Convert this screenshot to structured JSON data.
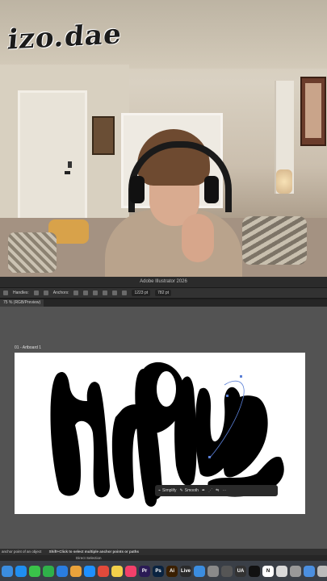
{
  "overlay": {
    "logo_text": "izo.dae"
  },
  "app": {
    "title": "Adobe Illustrator 2026"
  },
  "controlbar": {
    "handles_label": "Handles:",
    "anchors_label": "Anchors:",
    "x_value": "1223 pt",
    "y_value": "782 pt"
  },
  "document_tab": {
    "label": "75 % (RGB/Preview)"
  },
  "artboard": {
    "label": "01 - Artboard 1",
    "lettering": "unpluug"
  },
  "context_bar": {
    "simplify_label": "Simplify",
    "smooth_label": "Smooth"
  },
  "statusbar": {
    "text": "anchor point of an object",
    "hint": "Shift+Click to select multiple anchor points or paths",
    "tool": "Direct Selection"
  },
  "dock": {
    "icons": [
      {
        "name": "finder-icon",
        "color": "#3b8de0"
      },
      {
        "name": "app-store-icon",
        "color": "#1f8ef1"
      },
      {
        "name": "messages-icon",
        "color": "#3ac34a"
      },
      {
        "name": "facetime-icon",
        "color": "#2fb04a"
      },
      {
        "name": "mail-icon",
        "color": "#2a7de1"
      },
      {
        "name": "photos-icon",
        "color": "#e9a23b"
      },
      {
        "name": "safari-icon",
        "color": "#1e90ff"
      },
      {
        "name": "chrome-icon",
        "color": "#e24a3b"
      },
      {
        "name": "notes-icon",
        "color": "#f2d04a"
      },
      {
        "name": "music-icon",
        "color": "#f2406a"
      },
      {
        "name": "premiere-icon",
        "color": "#2a1b55",
        "label": "Pr"
      },
      {
        "name": "photoshop-icon",
        "color": "#0a2340",
        "label": "Ps"
      },
      {
        "name": "illustrator-icon",
        "color": "#3a1f00",
        "label": "Ai"
      },
      {
        "name": "live-icon",
        "color": "#2a2a2a",
        "label": "Live"
      },
      {
        "name": "folder-icon",
        "color": "#3b8de0"
      },
      {
        "name": "settings-icon",
        "color": "#8a8a8a"
      },
      {
        "name": "record-icon",
        "color": "#555"
      },
      {
        "name": "ua-icon",
        "color": "#333",
        "label": "UA"
      },
      {
        "name": "capcut-icon",
        "color": "#111"
      },
      {
        "name": "notion-icon",
        "color": "#fff",
        "label": "N"
      },
      {
        "name": "preview-icon",
        "color": "#d9d9d9"
      },
      {
        "name": "screenshot-icon",
        "color": "#999"
      },
      {
        "name": "downloads-icon",
        "color": "#4b8fe0"
      },
      {
        "name": "trash-icon",
        "color": "#bbb"
      }
    ]
  }
}
